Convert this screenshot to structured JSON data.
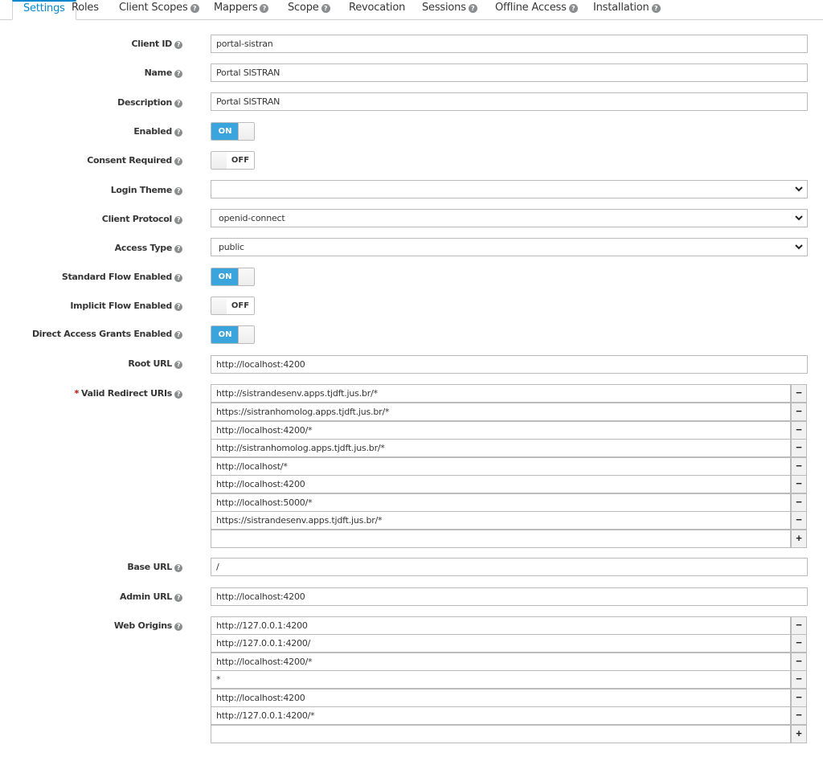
{
  "tabs": [
    {
      "label": "Settings",
      "help": false,
      "active": true
    },
    {
      "label": "Roles",
      "help": false
    },
    {
      "label": "Client Scopes",
      "help": true
    },
    {
      "label": "Mappers",
      "help": true
    },
    {
      "label": "Scope",
      "help": true
    },
    {
      "label": "Revocation",
      "help": false
    },
    {
      "label": "Sessions",
      "help": true
    },
    {
      "label": "Offline Access",
      "help": true
    },
    {
      "label": "Installation",
      "help": true
    }
  ],
  "help_glyph": "?",
  "form": {
    "client_id": {
      "label": "Client ID",
      "value": "portal-sistran"
    },
    "name": {
      "label": "Name",
      "value": "Portal SISTRAN"
    },
    "description": {
      "label": "Description",
      "value": "Portal SISTRAN"
    },
    "enabled": {
      "label": "Enabled",
      "state": "ON"
    },
    "consent_required": {
      "label": "Consent Required",
      "state": "OFF"
    },
    "login_theme": {
      "label": "Login Theme",
      "value": ""
    },
    "client_protocol": {
      "label": "Client Protocol",
      "value": "openid-connect"
    },
    "access_type": {
      "label": "Access Type",
      "value": "public"
    },
    "standard_flow": {
      "label": "Standard Flow Enabled",
      "state": "ON"
    },
    "implicit_flow": {
      "label": "Implicit Flow Enabled",
      "state": "OFF"
    },
    "direct_access": {
      "label": "Direct Access Grants Enabled",
      "state": "ON"
    },
    "root_url": {
      "label": "Root URL",
      "value": "http://localhost:4200"
    },
    "redirect_uris": {
      "required_marker": "*",
      "label": "Valid Redirect URIs",
      "values": [
        "http://sistrandesenv.apps.tjdft.jus.br/*",
        "https://sistranhomolog.apps.tjdft.jus.br/*",
        "http://localhost:4200/*",
        "http://sistranhomolog.apps.tjdft.jus.br/*",
        "http://localhost/*",
        "http://localhost:4200",
        "http://localhost:5000/*",
        "https://sistrandesenv.apps.tjdft.jus.br/*"
      ]
    },
    "base_url": {
      "label": "Base URL",
      "value": "/"
    },
    "admin_url": {
      "label": "Admin URL",
      "value": "http://localhost:4200"
    },
    "web_origins": {
      "label": "Web Origins",
      "values": [
        "http://127.0.0.1:4200",
        "http://127.0.0.1:4200/",
        "http://localhost:4200/*",
        "*",
        "http://localhost:4200",
        "http://127.0.0.1:4200/*"
      ]
    }
  },
  "buttons": {
    "remove": "−",
    "add": "+",
    "on": "ON",
    "off": "OFF"
  },
  "colors": {
    "accent": "#0088ce",
    "toggle_on": "#39a5dc",
    "required": "#cc0000"
  }
}
